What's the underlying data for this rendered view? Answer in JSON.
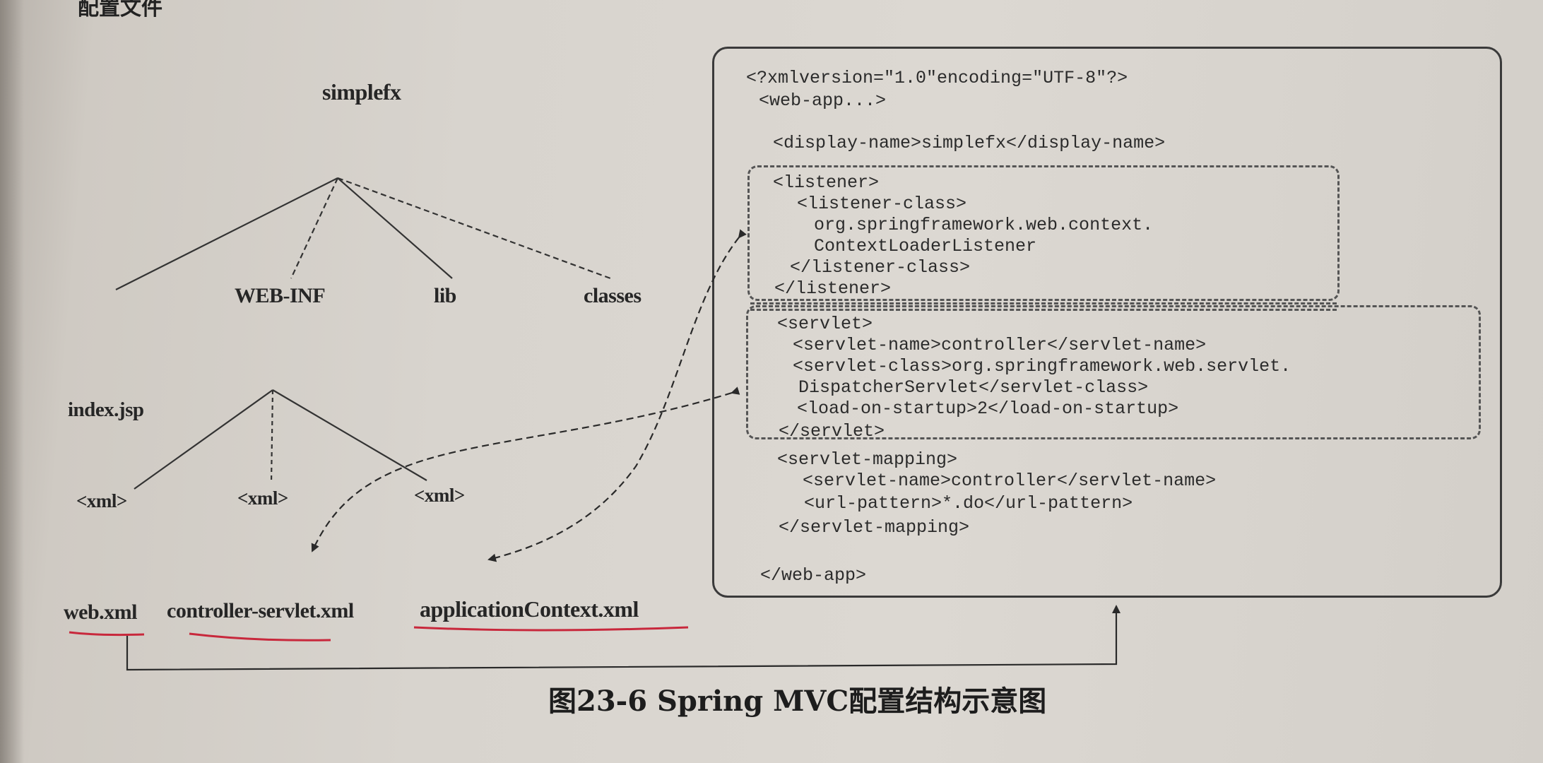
{
  "header_fragment": "配置文件",
  "tree": {
    "root": "simplefx",
    "children": [
      "WEB-INF",
      "lib",
      "classes"
    ],
    "second_root": "index.jsp",
    "xml_nodes": [
      "<xml>",
      "<xml>",
      "<xml>"
    ]
  },
  "files": [
    "web.xml",
    "controller-servlet.xml",
    "applicationContext.xml"
  ],
  "code_lines": [
    "<?xmlversion=\"1.0\"encoding=\"UTF-8\"?>",
    "<web-app...>",
    "<display-name>simplefx</display-name>",
    "<listener>",
    "<listener-class>",
    "org.springframework.web.context.",
    "ContextLoaderListener",
    "</listener-class>",
    "</listener>",
    "<servlet>",
    "<servlet-name>controller</servlet-name>",
    "<servlet-class>org.springframework.web.servlet.",
    "DispatcherServlet</servlet-class>",
    "<load-on-startup>2</load-on-startup>",
    "</servlet>",
    "<servlet-mapping>",
    "<servlet-name>controller</servlet-name>",
    "<url-pattern>*.do</url-pattern>",
    "</servlet-mapping>",
    "</web-app>"
  ],
  "caption": "图23-6   Spring MVC配置结构示意图",
  "colors": {
    "underline": "#c8283c",
    "ink": "#2b2b2b"
  }
}
